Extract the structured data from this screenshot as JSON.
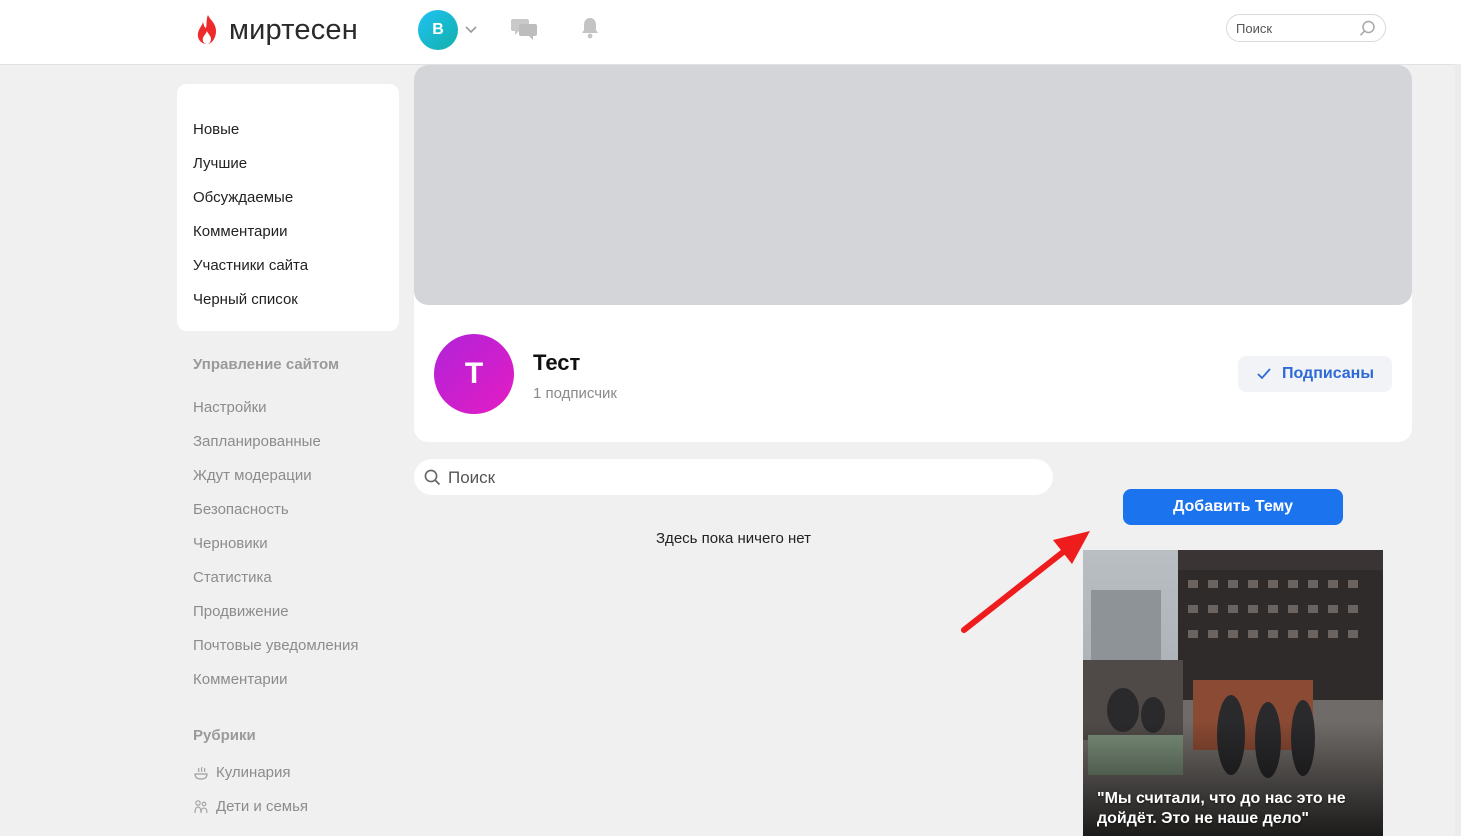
{
  "header": {
    "logo_text": "миртесен",
    "user_initial": "В",
    "search_placeholder": "Поиск"
  },
  "sidebar": {
    "feed_items": [
      {
        "label": "Новые"
      },
      {
        "label": "Лучшие"
      },
      {
        "label": "Обсуждаемые"
      },
      {
        "label": "Комментарии"
      },
      {
        "label": "Участники сайта"
      },
      {
        "label": "Черный список"
      }
    ],
    "manage_heading": "Управление сайтом",
    "manage_items": [
      {
        "label": "Настройки"
      },
      {
        "label": "Запланированные"
      },
      {
        "label": "Ждут модерации"
      },
      {
        "label": "Безопасность"
      },
      {
        "label": "Черновики"
      },
      {
        "label": "Статистика"
      },
      {
        "label": "Продвижение"
      },
      {
        "label": "Почтовые уведомления"
      },
      {
        "label": "Комментарии"
      }
    ],
    "rubrics_heading": "Рубрики",
    "rubrics": [
      {
        "label": "Кулинария",
        "icon": "cooking-icon"
      },
      {
        "label": "Дети и семья",
        "icon": "family-icon"
      }
    ]
  },
  "group": {
    "avatar_letter": "Т",
    "name": "Тест",
    "subscribers": "1 подписчик",
    "subscribe_label": "Подписаны"
  },
  "main": {
    "search_placeholder": "Поиск",
    "empty_text": "Здесь пока ничего нет",
    "add_topic_label": "Добавить Тему"
  },
  "news": {
    "caption": "\"Мы считали, что до нас это не дойдёт. Это не наше дело\""
  },
  "colors": {
    "accent_blue": "#1c73ee",
    "link_blue": "#2e6ad7",
    "logo_red": "#ee2b2b",
    "annotation_red": "#ee1c1c"
  }
}
